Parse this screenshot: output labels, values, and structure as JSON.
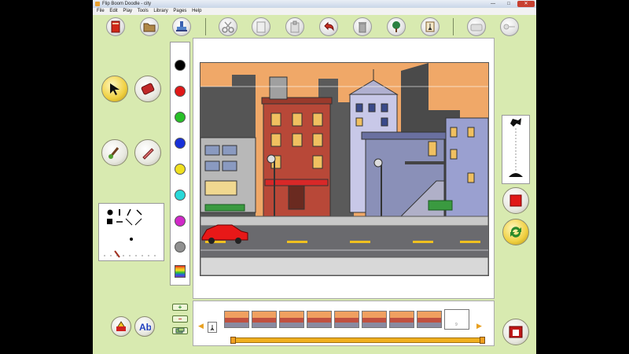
{
  "window": {
    "title": "Flip Boom Doodle - city",
    "minimize": "—",
    "maximize": "□",
    "close": "✕"
  },
  "menu": [
    "File",
    "Edit",
    "Play",
    "Tools",
    "Library",
    "Pages",
    "Help"
  ],
  "toolbar": {
    "icons": [
      "book-icon",
      "folder-icon",
      "stamp-icon",
      "scissors-icon",
      "copy-icon",
      "paste-icon",
      "undo-icon",
      "trash-icon",
      "tree-icon",
      "character-icon",
      "camera-icon",
      "key-icon"
    ]
  },
  "tools": {
    "select": "select-arrow-icon",
    "eraser": "eraser-icon",
    "brush": "paintbrush-icon",
    "pencil": "pencil-icon"
  },
  "palette": {
    "colors": [
      "#000000",
      "#e01818",
      "#28c028",
      "#1830d8",
      "#f0e020",
      "#28d8d8",
      "#d028c8",
      "#909090"
    ],
    "rainbow": "rainbow-swatch"
  },
  "frame_buttons": {
    "add": "+",
    "remove": "−"
  },
  "timeline": {
    "frame_count": 8,
    "prev": "◀",
    "next": "▶",
    "empty_frame_label": "9"
  },
  "side": {
    "record": "record-icon",
    "loop": "loop-icon",
    "theater": "theater-icon"
  },
  "colors": {
    "accent": "#d8eab0",
    "timeline": "#f0b020"
  }
}
